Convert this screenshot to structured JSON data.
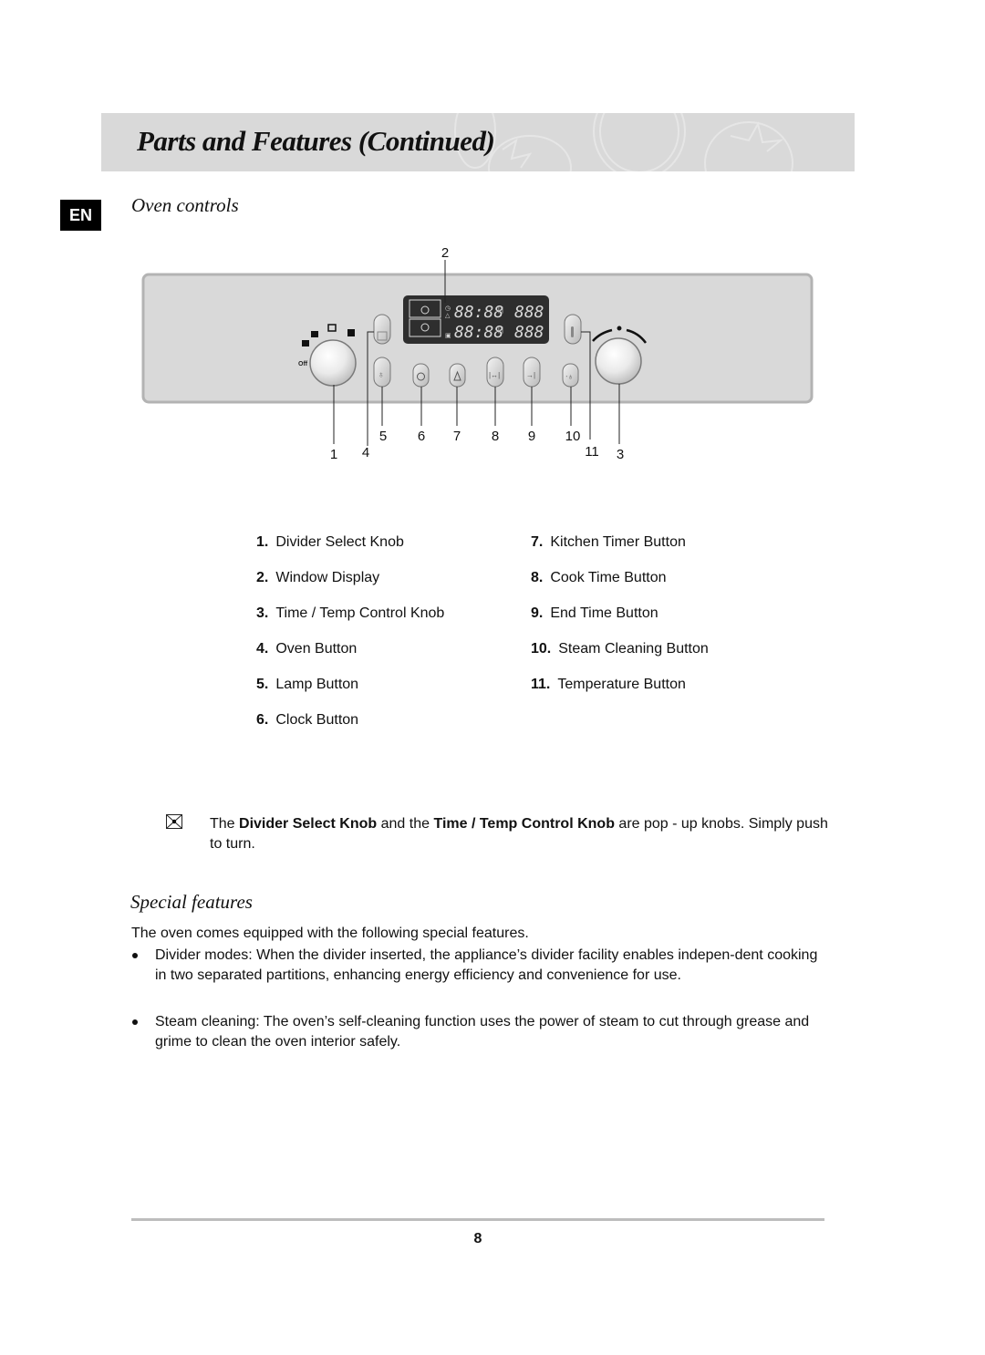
{
  "header": {
    "title": "Parts and Features (Continued)",
    "language_badge": "EN"
  },
  "oven_controls": {
    "heading": "Oven controls",
    "diagram": {
      "callouts": [
        "1",
        "2",
        "3",
        "4",
        "5",
        "6",
        "7",
        "8",
        "9",
        "10",
        "11"
      ],
      "knob_off_label": "Off",
      "display_rows": [
        {
          "time": "88:88",
          "temp": "888"
        },
        {
          "time": "88:88",
          "temp": "888"
        }
      ],
      "temp_units": [
        "F",
        "c"
      ]
    },
    "parts_left": [
      {
        "num": "1.",
        "label": "Divider Select Knob"
      },
      {
        "num": "2.",
        "label": "Window Display"
      },
      {
        "num": "3.",
        "label": "Time / Temp Control Knob"
      },
      {
        "num": "4.",
        "label": "Oven Button"
      },
      {
        "num": "5.",
        "label": "Lamp Button"
      },
      {
        "num": "6.",
        "label": "Clock Button"
      }
    ],
    "parts_right": [
      {
        "num": "7.",
        "label": "Kitchen Timer Button"
      },
      {
        "num": "8.",
        "label": "Cook Time Button"
      },
      {
        "num": "9.",
        "label": "End Time Button"
      },
      {
        "num": "10.",
        "label": "Steam Cleaning Button"
      },
      {
        "num": "11.",
        "label": "Temperature Button"
      }
    ],
    "note": {
      "icon": "note-envelope-icon",
      "part1": "The ",
      "bold1": "Divider Select Knob",
      "part2": " and the ",
      "bold2": "Time / Temp Control Knob",
      "part3": " are pop - up knobs. Simply push to turn."
    }
  },
  "special_features": {
    "heading": "Special features",
    "intro": "The oven comes equipped with the following special features.",
    "bullets": [
      "Divider modes: When the divider inserted, the appliance’s divider facility enables indepen-dent cooking in two separated partitions, enhancing energy efficiency and convenience for use.",
      "Steam cleaning: The oven’s self-cleaning function uses the power of steam to cut through grease and grime to clean the oven interior safely."
    ]
  },
  "footer": {
    "page_number": "8"
  },
  "colors": {
    "banner": "#d9d9d9",
    "panel": "#d9d9d9",
    "display": "#2e2e2e",
    "segment": "#d8d8d8"
  }
}
